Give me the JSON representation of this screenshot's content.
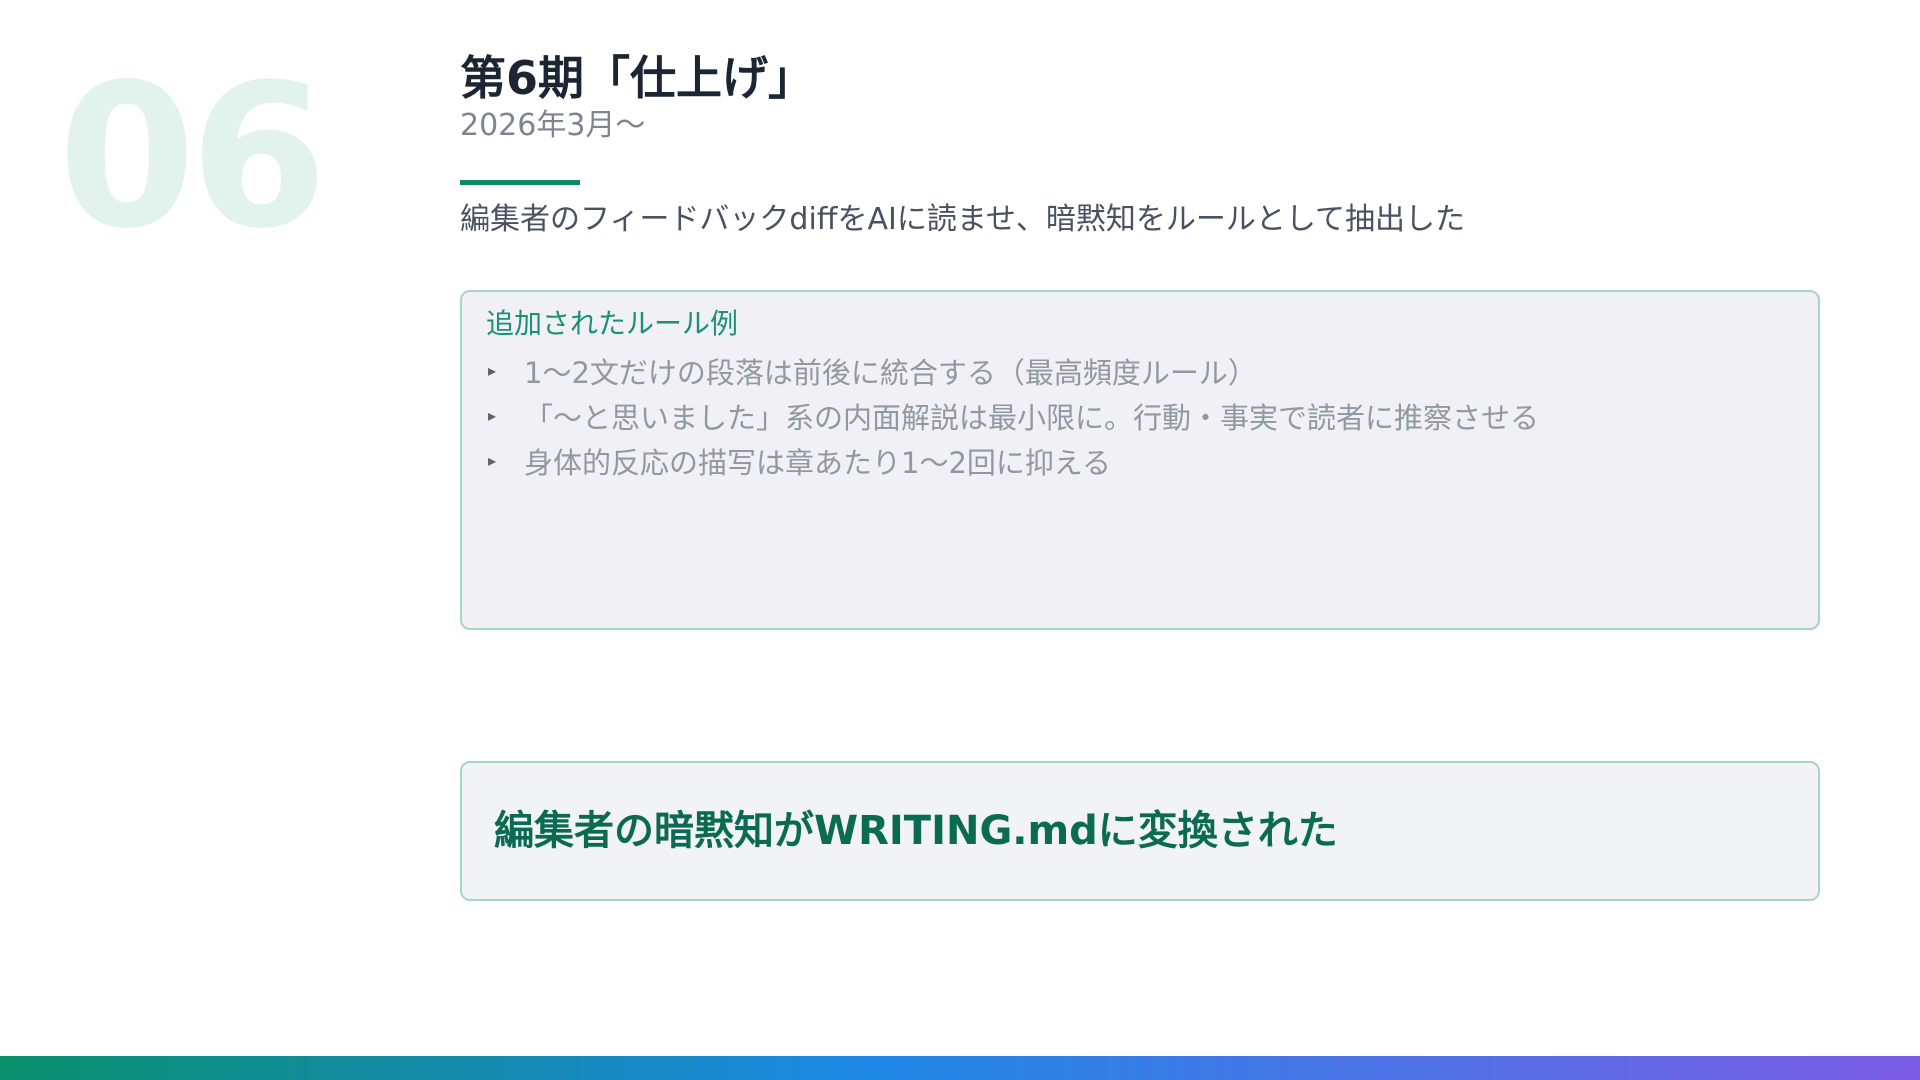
{
  "section": {
    "number": "06",
    "title": "第6期「仕上げ」",
    "date": "2026年3月〜",
    "subtitle": "編集者のフィードバックdiffをAIに読ませ、暗黙知をルールとして抽出した"
  },
  "rules_box": {
    "heading": "追加されたルール例",
    "items": [
      "1〜2文だけの段落は前後に統合する（最高頻度ルール）",
      "「〜と思いました」系の内面解説は最小限に。行動・事実で読者に推察させる",
      "身体的反応の描写は章あたり1〜2回に抑える"
    ]
  },
  "conclusion": {
    "text": "編集者の暗黙知がWRITING.mdに変換された"
  },
  "colors": {
    "accent": "#0f8a68",
    "gradient_start": "#0a8f6c",
    "gradient_mid": "#1e88e5",
    "gradient_end": "#7b5ce6"
  }
}
